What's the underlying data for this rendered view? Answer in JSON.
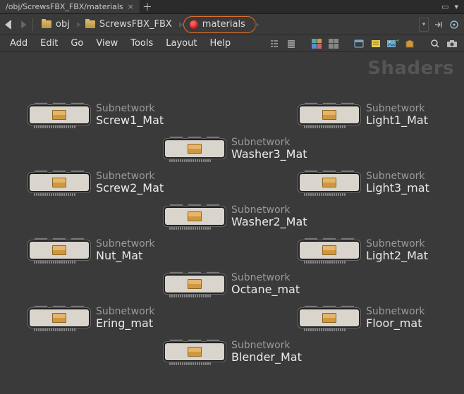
{
  "tab": {
    "title": "/obj/ScrewsFBX_FBX/materials"
  },
  "breadcrumbs": {
    "a": "obj",
    "b": "ScrewsFBX_FBX",
    "c": "materials"
  },
  "menu": {
    "add": "Add",
    "edit": "Edit",
    "go": "Go",
    "view": "View",
    "tools": "Tools",
    "layout": "Layout",
    "help": "Help"
  },
  "watermark": "Shaders",
  "nodetype": "Subnetwork",
  "nodes": {
    "screw1": "Screw1_Mat",
    "light1": "Light1_Mat",
    "washer3": "Washer3_Mat",
    "screw2": "Screw2_Mat",
    "light3": "Light3_mat",
    "washer2": "Washer2_Mat",
    "nut": "Nut_Mat",
    "light2": "Light2_Mat",
    "octane": "Octane_mat",
    "ering": "Ering_mat",
    "floor": "Floor_mat",
    "blender": "Blender_Mat"
  }
}
